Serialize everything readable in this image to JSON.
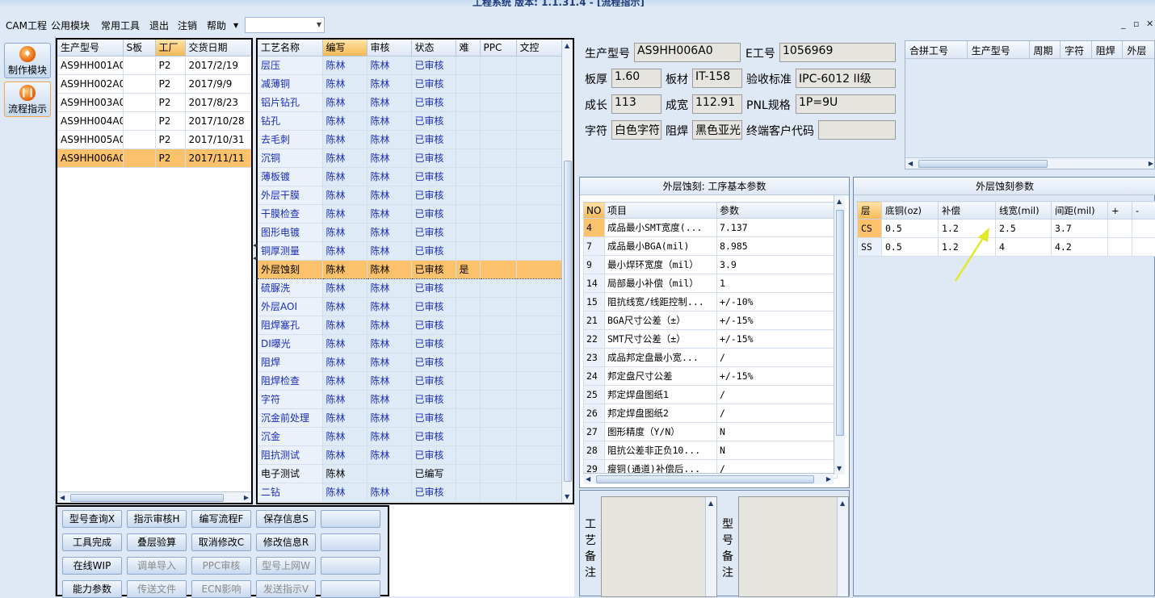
{
  "window": {
    "title": "工程系统 版本: 1.1.31.4 - [流程指示]"
  },
  "menu": {
    "items": [
      "CAM工程",
      "公用模块",
      "常用工具",
      "退出",
      "注销",
      "帮助"
    ],
    "combo_value": ""
  },
  "nav": {
    "items": [
      {
        "label": "制作模块",
        "icon": "flame-icon"
      },
      {
        "label": "流程指示",
        "icon": "pause-icon"
      }
    ]
  },
  "models": {
    "headers": [
      "生产型号",
      "S板",
      "工厂",
      "交货日期"
    ],
    "rows": [
      [
        "AS9HH001A0",
        "",
        "P2",
        "2017/2/19"
      ],
      [
        "AS9HH002A0",
        "",
        "P2",
        "2017/9/9"
      ],
      [
        "AS9HH003A0",
        "",
        "P2",
        "2017/8/23"
      ],
      [
        "AS9HH004A0",
        "",
        "P2",
        "2017/10/28"
      ],
      [
        "AS9HH005A0",
        "",
        "P2",
        "2017/10/31"
      ],
      [
        "AS9HH006A0",
        "",
        "P2",
        "2017/11/11"
      ]
    ],
    "selected": 5
  },
  "process": {
    "headers": [
      "工艺名称",
      "编写",
      "审核",
      "状态",
      "难",
      "PPC",
      "文控"
    ],
    "rows": [
      [
        "层压",
        "陈林",
        "陈林",
        "已审核",
        "",
        "",
        ""
      ],
      [
        "减薄铜",
        "陈林",
        "陈林",
        "已审核",
        "",
        "",
        ""
      ],
      [
        "铝片钻孔",
        "陈林",
        "陈林",
        "已审核",
        "",
        "",
        ""
      ],
      [
        "钻孔",
        "陈林",
        "陈林",
        "已审核",
        "",
        "",
        ""
      ],
      [
        "去毛刺",
        "陈林",
        "陈林",
        "已审核",
        "",
        "",
        ""
      ],
      [
        "沉铜",
        "陈林",
        "陈林",
        "已审核",
        "",
        "",
        ""
      ],
      [
        "薄板镀",
        "陈林",
        "陈林",
        "已审核",
        "",
        "",
        ""
      ],
      [
        "外层干膜",
        "陈林",
        "陈林",
        "已审核",
        "",
        "",
        ""
      ],
      [
        "干膜检查",
        "陈林",
        "陈林",
        "已审核",
        "",
        "",
        ""
      ],
      [
        "图形电镀",
        "陈林",
        "陈林",
        "已审核",
        "",
        "",
        ""
      ],
      [
        "铜厚测量",
        "陈林",
        "陈林",
        "已审核",
        "",
        "",
        ""
      ],
      [
        "外层蚀刻",
        "陈林",
        "陈林",
        "已审核",
        "是",
        "",
        ""
      ],
      [
        "硫脲洗",
        "陈林",
        "陈林",
        "已审核",
        "",
        "",
        ""
      ],
      [
        "外层AOI",
        "陈林",
        "陈林",
        "已审核",
        "",
        "",
        ""
      ],
      [
        "阻焊塞孔",
        "陈林",
        "陈林",
        "已审核",
        "",
        "",
        ""
      ],
      [
        "DI曝光",
        "陈林",
        "陈林",
        "已审核",
        "",
        "",
        ""
      ],
      [
        "阻焊",
        "陈林",
        "陈林",
        "已审核",
        "",
        "",
        ""
      ],
      [
        "阻焊检查",
        "陈林",
        "陈林",
        "已审核",
        "",
        "",
        ""
      ],
      [
        "字符",
        "陈林",
        "陈林",
        "已审核",
        "",
        "",
        ""
      ],
      [
        "沉金前处理",
        "陈林",
        "陈林",
        "已审核",
        "",
        "",
        ""
      ],
      [
        "沉金",
        "陈林",
        "陈林",
        "已审核",
        "",
        "",
        ""
      ],
      [
        "阻抗测试",
        "陈林",
        "陈林",
        "已审核",
        "",
        "",
        ""
      ],
      [
        "电子测试",
        "陈林",
        "",
        "已编写",
        "",
        "",
        ""
      ],
      [
        "二钻",
        "陈林",
        "陈林",
        "已审核",
        "",
        "",
        ""
      ]
    ],
    "selected": 11
  },
  "info": {
    "model_label": "生产型号",
    "model": "AS9HH006A0",
    "e_label": "E工号",
    "e_no": "1056969",
    "thick_label": "板厚",
    "thick": "1.60",
    "mat_label": "板材",
    "mat": "IT-158",
    "std_label": "验收标准",
    "std": "IPC-6012 II级",
    "len_label": "成长",
    "len": "113",
    "wid_label": "成宽",
    "wid": "112.91",
    "pnl_label": "PNL规格",
    "pnl": "1P=9U",
    "char_label": "字符",
    "char": "白色字符",
    "mask_label": "阻焊",
    "mask": "黑色亚光",
    "cust_label": "终端客户代码",
    "cust": ""
  },
  "merge": {
    "headers": [
      "合拼工号",
      "生产型号",
      "周期",
      "字符",
      "阻焊",
      "外层"
    ]
  },
  "buttons": [
    {
      "label": "型号查询X",
      "enabled": true
    },
    {
      "label": "指示审核H",
      "enabled": true
    },
    {
      "label": "编写流程F",
      "enabled": true
    },
    {
      "label": "保存信息S",
      "enabled": true
    },
    {
      "label": "",
      "enabled": true
    },
    {
      "label": "工具完成",
      "enabled": true
    },
    {
      "label": "叠层验算",
      "enabled": true
    },
    {
      "label": "取消修改C",
      "enabled": true
    },
    {
      "label": "修改信息R",
      "enabled": true
    },
    {
      "label": "",
      "enabled": true
    },
    {
      "label": "在线WIP",
      "enabled": true
    },
    {
      "label": "调单导入",
      "enabled": false
    },
    {
      "label": "PPC审核",
      "enabled": false
    },
    {
      "label": "型号上网W",
      "enabled": false
    },
    {
      "label": "",
      "enabled": true
    },
    {
      "label": "能力参数",
      "enabled": true
    },
    {
      "label": "传送文件",
      "enabled": false
    },
    {
      "label": "ECN影响",
      "enabled": false
    },
    {
      "label": "发送指示V",
      "enabled": false
    },
    {
      "label": "",
      "enabled": true
    }
  ],
  "basic": {
    "title": "外层蚀刻: 工序基本参数",
    "headers": [
      "NO",
      "项目",
      "参数"
    ],
    "rows": [
      [
        "4",
        "成品最小SMT宽度(...",
        "7.137"
      ],
      [
        "7",
        "成品最小BGA(mil)",
        "8.985"
      ],
      [
        "9",
        "最小焊环宽度（mil）",
        "3.9"
      ],
      [
        "14",
        "局部最小补偿（mil）",
        "1"
      ],
      [
        "15",
        "阻抗线宽/线距控制...",
        "+/-10%"
      ],
      [
        "21",
        "BGA尺寸公差（±）",
        "+/-15%"
      ],
      [
        "22",
        "SMT尺寸公差（±）",
        "+/-15%"
      ],
      [
        "23",
        "成品邦定盘最小宽...",
        "/"
      ],
      [
        "24",
        "邦定盘尺寸公差",
        "+/-15%"
      ],
      [
        "25",
        "邦定焊盘图纸1",
        "/"
      ],
      [
        "26",
        "邦定焊盘图纸2",
        "/"
      ],
      [
        "27",
        "图形精度（Y/N）",
        "N"
      ],
      [
        "28",
        "阻抗公差非正负10...",
        "N"
      ],
      [
        "29",
        "瘦铜(通道)补偿后...",
        "/"
      ]
    ],
    "selected": 0
  },
  "etch": {
    "title": "外层蚀刻参数",
    "headers": [
      "层",
      "底铜(oz)",
      "补偿",
      "线宽(mil)",
      "间距(mil)",
      "+",
      "-"
    ],
    "rows": [
      [
        "CS",
        "0.5",
        "1.2",
        "2.5",
        "3.7",
        "",
        ""
      ],
      [
        "SS",
        "0.5",
        "1.2",
        "4",
        "4.2",
        "",
        ""
      ]
    ]
  },
  "notes": {
    "process_label": [
      "工",
      "艺",
      "备",
      "注"
    ],
    "model_label": [
      "型",
      "号",
      "备",
      "注"
    ]
  },
  "colors": {
    "selected_row": "#fcc16b",
    "accent_arrow": "#e3e82a",
    "link_text": "#1a2db5"
  }
}
